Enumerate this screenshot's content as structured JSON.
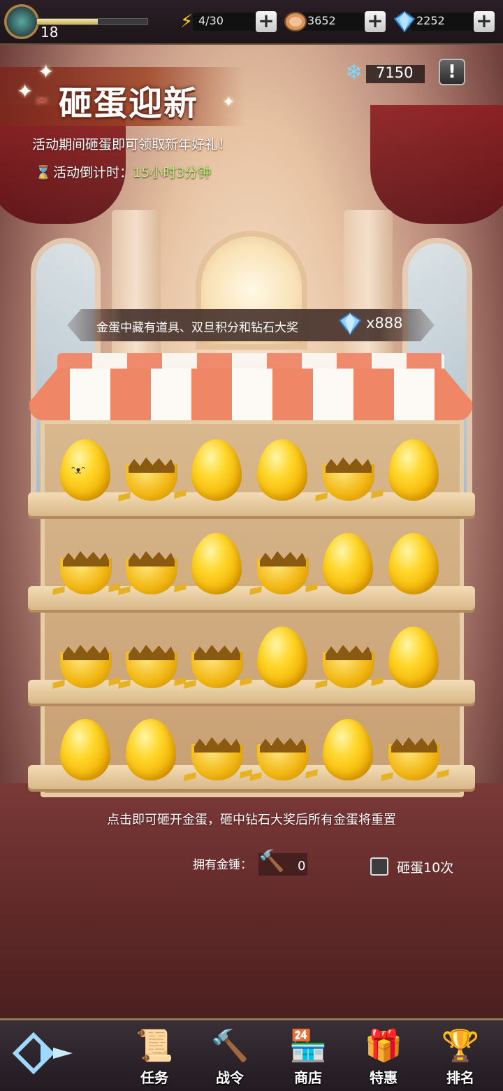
{
  "topbar": {
    "level": "18",
    "level_progress": 0.55,
    "stamina": "4/30",
    "coins": "3652",
    "gems": "2252",
    "plus": "+"
  },
  "event": {
    "title": "砸蛋迎新",
    "subtitle": "活动期间砸蛋即可领取新年好礼！",
    "countdown_label": "活动倒计时：",
    "countdown_value": "15小时3分钟",
    "snowflakes": "7150",
    "info": "!"
  },
  "prize": {
    "text": "金蛋中藏有道具、双旦积分和钻石大奖",
    "amount": "x888"
  },
  "eggs": {
    "rows": [
      [
        "whole-face",
        "broken",
        "whole",
        "whole",
        "broken",
        "whole"
      ],
      [
        "broken",
        "broken",
        "whole",
        "broken",
        "whole",
        "whole"
      ],
      [
        "broken",
        "broken",
        "broken",
        "whole",
        "broken",
        "whole"
      ],
      [
        "whole",
        "whole",
        "broken",
        "broken",
        "whole",
        "broken"
      ]
    ],
    "face": "ᵔᴥᵔ"
  },
  "footer": {
    "tip": "点击即可砸开金蛋，砸中钻石大奖后所有金蛋将重置",
    "hammer_label": "拥有金锤：",
    "hammer_count": "0",
    "smash10_label": "砸蛋10次"
  },
  "nav": {
    "items": [
      {
        "label": "任务",
        "icon": "scroll-icon"
      },
      {
        "label": "战令",
        "icon": "hammer-icon"
      },
      {
        "label": "商店",
        "icon": "shop-icon"
      },
      {
        "label": "特惠",
        "icon": "gift-icon"
      },
      {
        "label": "排名",
        "icon": "trophy-icon"
      }
    ]
  },
  "colors": {
    "accent_green": "#b9f07a",
    "gold": "#ffd62a",
    "awning_red": "#ef8766"
  }
}
